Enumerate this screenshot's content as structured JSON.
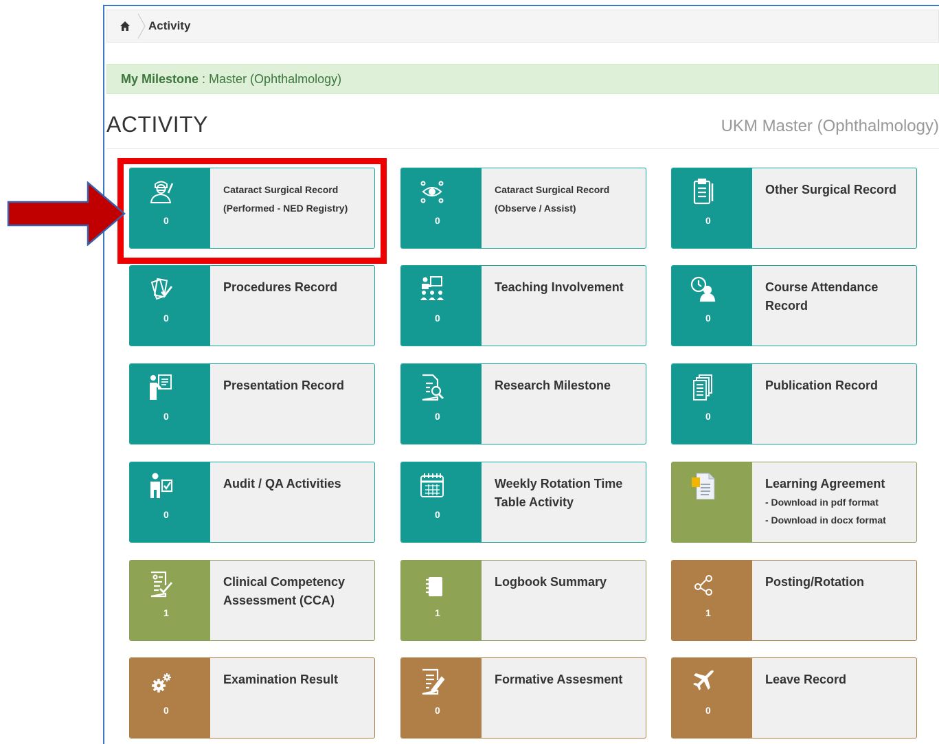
{
  "breadcrumb": {
    "home_icon": "home-icon",
    "current": "Activity"
  },
  "milestone": {
    "label": "My Milestone",
    "separator": " : ",
    "value": "Master (Ophthalmology)"
  },
  "page": {
    "title": "ACTIVITY",
    "subtitle": "UKM Master (Ophthalmology)"
  },
  "colors": {
    "teal": "#149a93",
    "olive": "#8ea353",
    "brown": "#b07f47",
    "highlight": "#ee0000",
    "arrow": "#c00000"
  },
  "tiles": [
    {
      "label_line1": "Cataract Surgical Record",
      "label_line2": "(Performed - NED Registry)",
      "count": "0",
      "icon": "surgeon-icon",
      "color": "teal"
    },
    {
      "label_line1": "Cataract Surgical Record",
      "label_line2": "(Observe / Assist)",
      "count": "0",
      "icon": "eye-icon",
      "color": "teal"
    },
    {
      "label_line1": "Other Surgical Record",
      "count": "0",
      "icon": "clipboard-icon",
      "color": "teal"
    },
    {
      "label_line1": "Procedures Record",
      "count": "0",
      "icon": "documents-check-icon",
      "color": "teal"
    },
    {
      "label_line1": "Teaching Involvement",
      "count": "0",
      "icon": "teacher-class-icon",
      "color": "teal"
    },
    {
      "label_line1": "Course Attendance",
      "label_line2": "Record",
      "count": "0",
      "icon": "clock-person-icon",
      "color": "teal"
    },
    {
      "label_line1": "Presentation Record",
      "count": "0",
      "icon": "presenter-board-icon",
      "color": "teal"
    },
    {
      "label_line1": "Research Milestone",
      "count": "0",
      "icon": "document-search-icon",
      "color": "teal"
    },
    {
      "label_line1": "Publication Record",
      "count": "0",
      "icon": "stacked-papers-icon",
      "color": "teal"
    },
    {
      "label_line1": "Audit / QA Activities",
      "count": "0",
      "icon": "person-checklist-icon",
      "color": "teal"
    },
    {
      "label_line1": "Weekly Rotation Time",
      "label_line2": "Table Activity",
      "count": "0",
      "icon": "calendar-icon",
      "color": "teal"
    },
    {
      "label_line1": "Learning Agreement",
      "link1": "- Download in pdf format",
      "link2": "- Download in docx format",
      "icon": "document-file-icon",
      "color": "olive"
    },
    {
      "label_line1": "Clinical Competency",
      "label_line2": "Assessment (CCA)",
      "count": "1",
      "icon": "assessment-form-icon",
      "color": "olive"
    },
    {
      "label_line1": "Logbook Summary",
      "count": "1",
      "icon": "notebook-icon",
      "color": "olive"
    },
    {
      "label_line1": "Posting/Rotation",
      "count": "1",
      "icon": "share-nodes-icon",
      "color": "brown"
    },
    {
      "label_line1": "Examination Result",
      "count": "0",
      "icon": "gears-icon",
      "color": "brown"
    },
    {
      "label_line1": "Formative Assesment",
      "count": "0",
      "icon": "document-edit-icon",
      "color": "brown"
    },
    {
      "label_line1": "Leave Record",
      "count": "0",
      "icon": "plane-icon",
      "color": "brown"
    }
  ]
}
